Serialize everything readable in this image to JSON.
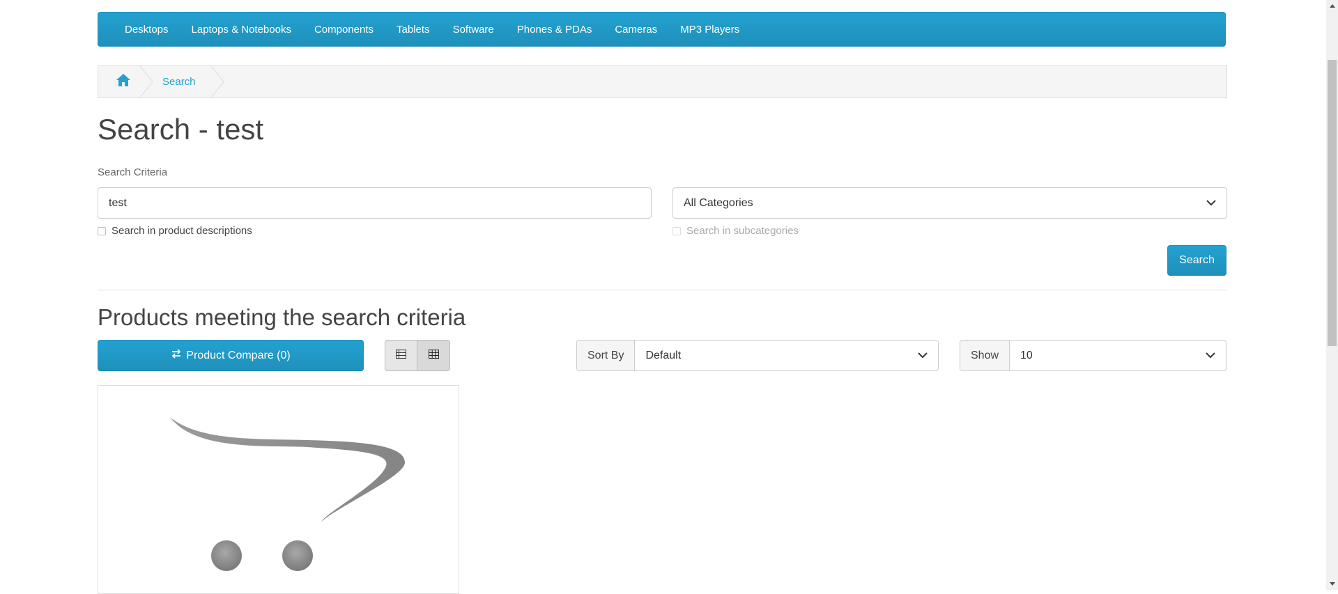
{
  "nav": {
    "items": [
      "Desktops",
      "Laptops & Notebooks",
      "Components",
      "Tablets",
      "Software",
      "Phones & PDAs",
      "Cameras",
      "MP3 Players"
    ]
  },
  "breadcrumb": {
    "home_icon": "home-icon",
    "current": "Search"
  },
  "page": {
    "title": "Search - test",
    "criteria_label": "Search Criteria",
    "search_value": "test",
    "category_selected": "All Categories",
    "desc_checkbox_label": "Search in product descriptions",
    "sub_checkbox_label": "Search in subcategories",
    "search_button": "Search"
  },
  "results": {
    "heading": "Products meeting the search criteria",
    "compare_button": "Product Compare (0)",
    "sort_label": "Sort By",
    "sort_value": "Default",
    "show_label": "Show",
    "show_value": "10"
  },
  "colors": {
    "accent": "#23a1d1",
    "accent_dark": "#1f90bb"
  }
}
